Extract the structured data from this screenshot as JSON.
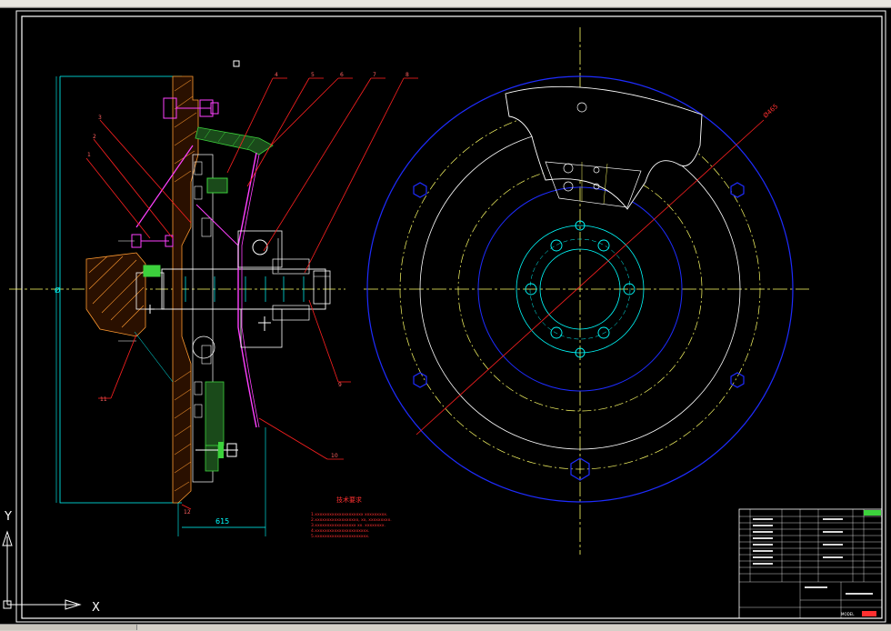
{
  "drawing": {
    "part_numbers": [
      "1",
      "2",
      "3",
      "4",
      "5",
      "6",
      "7",
      "8",
      "9",
      "10",
      "11",
      "12"
    ],
    "width_dimension": "615",
    "diameter_label": "Ø465",
    "left_marker": "Ø",
    "tech_req_title": "技术要求",
    "tech_req_lines": [
      "1.xxxxxxxxxxxxxxxxxxxx xxxxxxxxx.",
      "2.xxxxxxxxxxxxxxxxxx, xx, xxxxxxxxx.",
      "3.xxxxxxxxxxxxxxxxx xx. xxxxxxxx.",
      "4.xxxxxxxxxxxxxxxxxxxxxx.",
      "5.xxxxxxxxxxxxxxxxxxxxxx."
    ]
  },
  "ucs": {
    "y": "Y",
    "x": "X"
  },
  "colors": {
    "frame": "#ffffff",
    "dimension": "#00ffff",
    "centerline": "#ffff66",
    "blue": "#1e2cff",
    "leader": "#ff2020",
    "magenta": "#ff40ff",
    "green": "#3cd23c",
    "yellow": "#ffff00"
  },
  "title_block": {
    "logo_text": "MODEL"
  }
}
